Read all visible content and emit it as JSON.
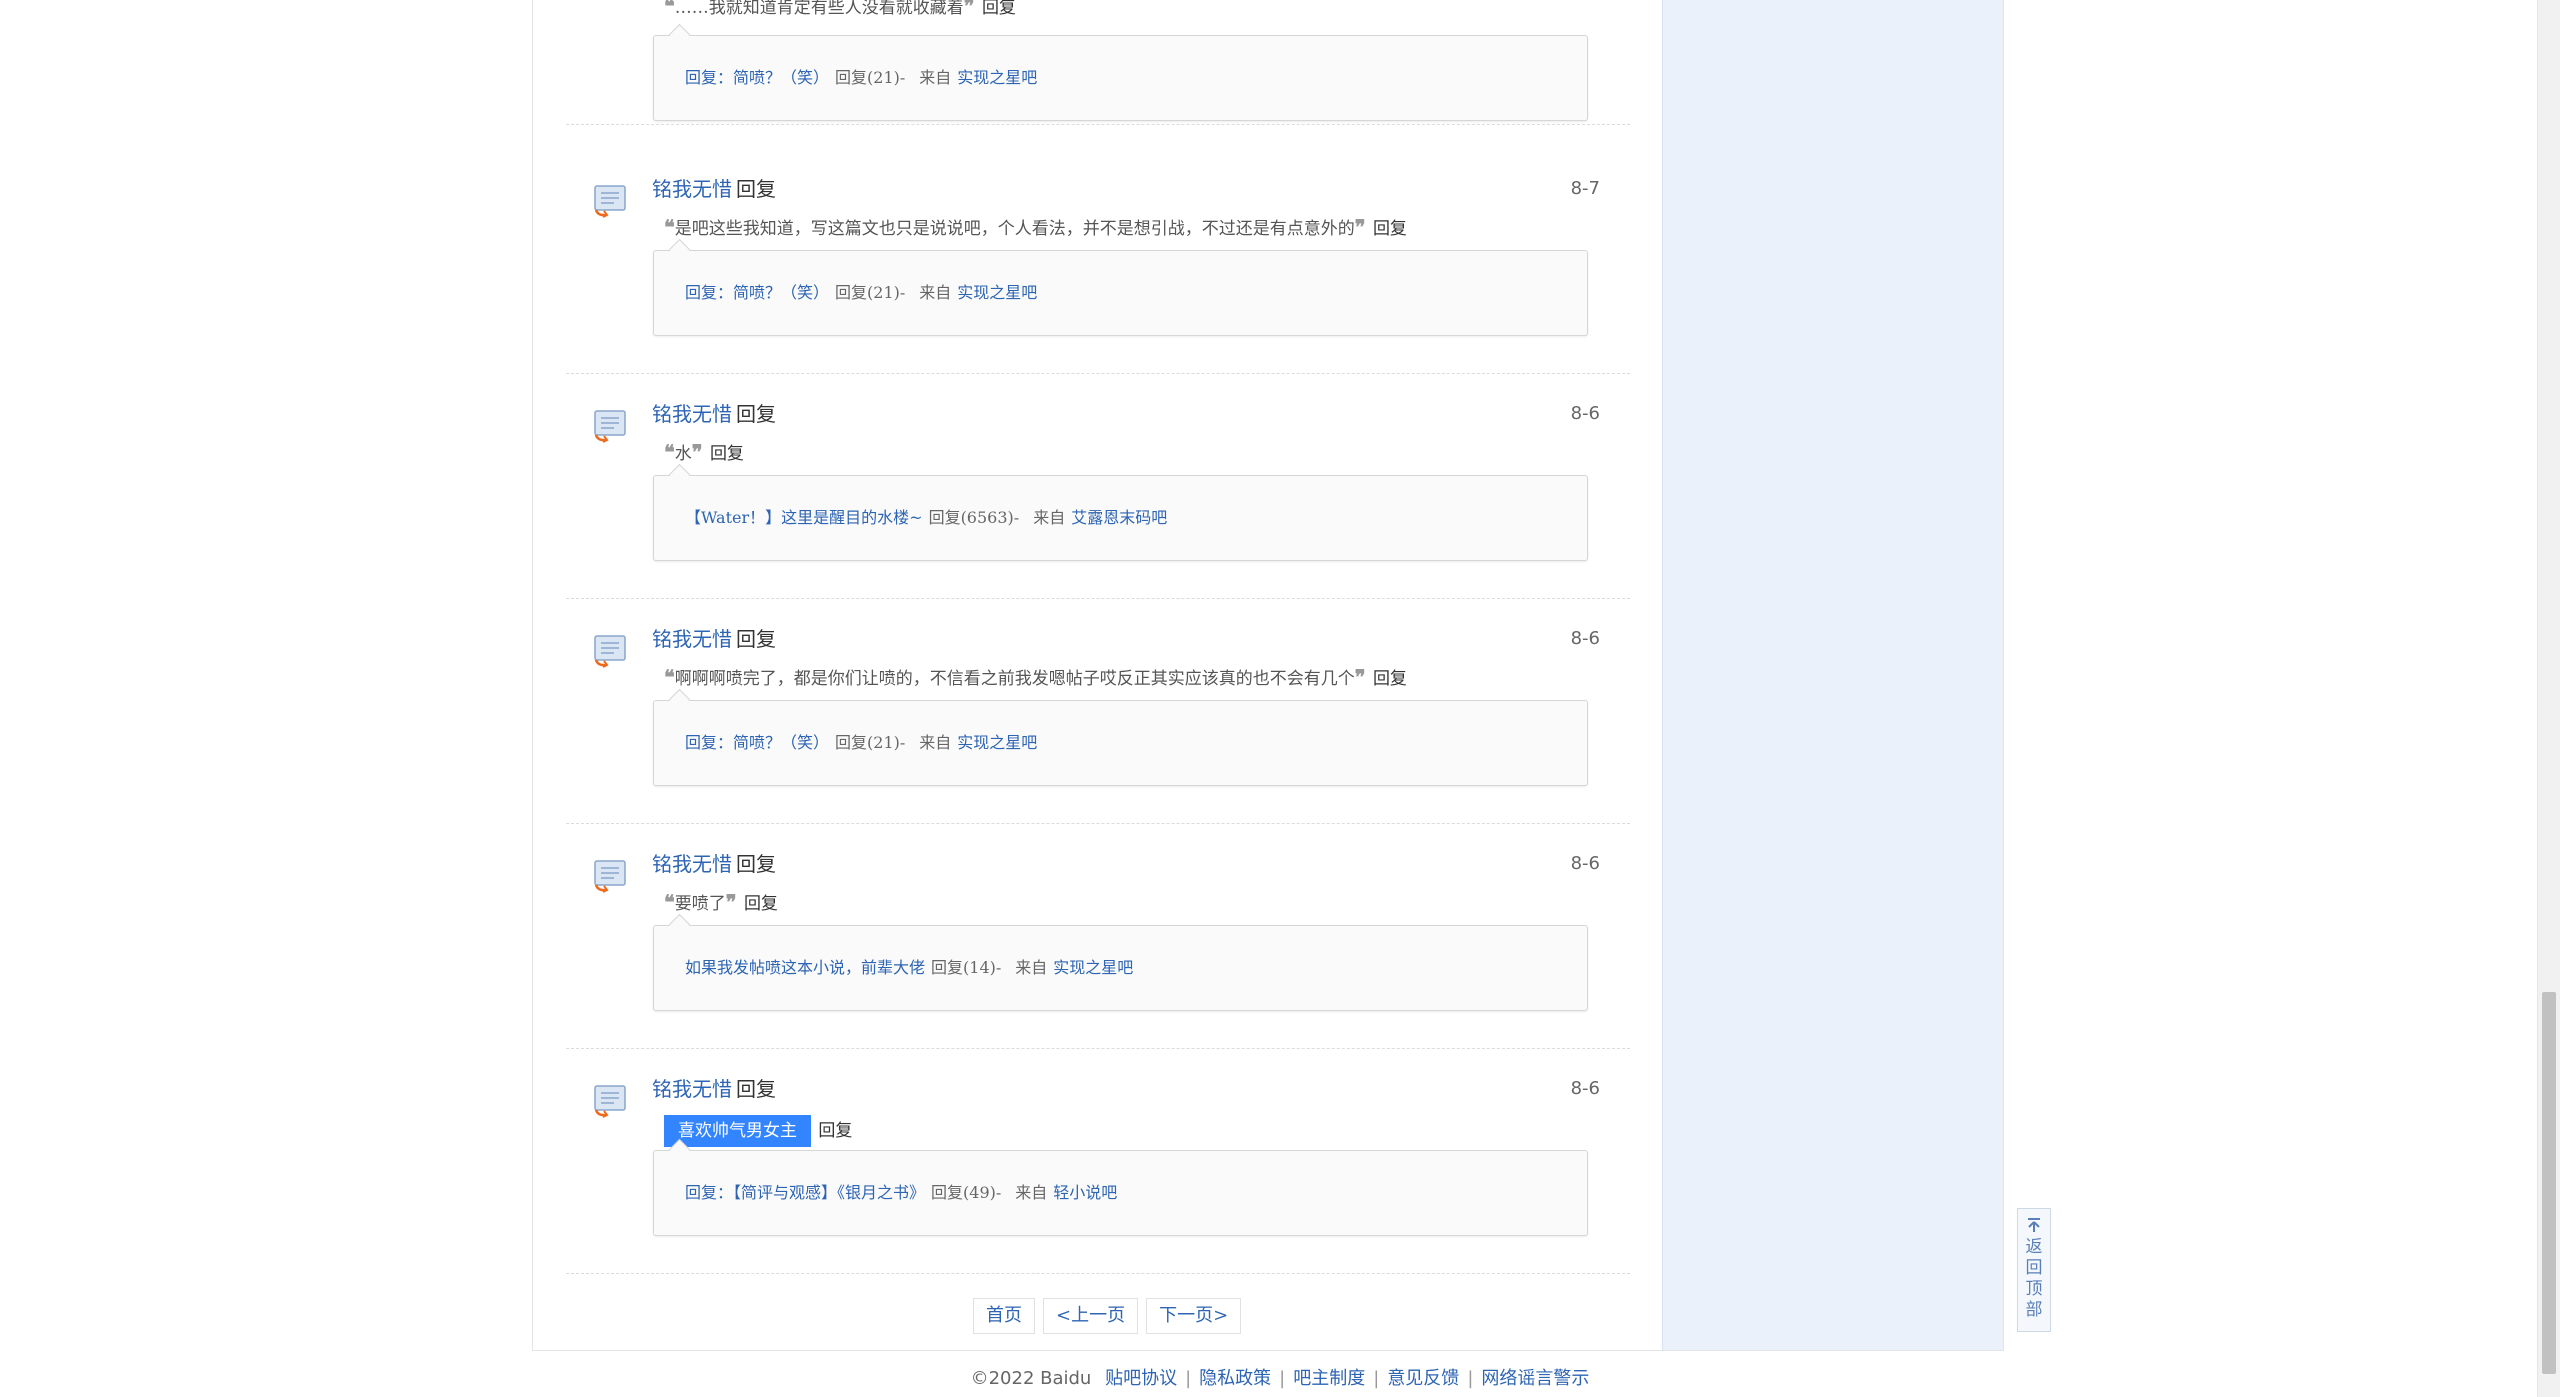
{
  "posts": [
    {
      "user": "",
      "verb": "",
      "date": "",
      "quote_open": "❝",
      "quote_text": "……我就知道肯定有些人没看就收藏着",
      "quote_close": "❞",
      "quote_reply": "回复",
      "ref_title": "回复：简喷？（笑）",
      "ref_count": "回复(21)-",
      "ref_from": "来自",
      "ref_forum": "实现之星吧"
    },
    {
      "user": "铭我无惜",
      "verb": "回复",
      "date": "8-7",
      "quote_open": "❝",
      "quote_text": "是吧这些我知道，写这篇文也只是说说吧，个人看法，并不是想引战，不过还是有点意外的",
      "quote_close": "❞",
      "quote_reply": "回复",
      "ref_title": "回复：简喷？（笑）",
      "ref_count": "回复(21)-",
      "ref_from": "来自",
      "ref_forum": "实现之星吧"
    },
    {
      "user": "铭我无惜",
      "verb": "回复",
      "date": "8-6",
      "quote_open": "❝",
      "quote_text": "水",
      "quote_close": "❞",
      "quote_reply": "回复",
      "ref_title": "【Water！】这里是醒目的水楼~",
      "ref_count": "回复(6563)-",
      "ref_from": "来自",
      "ref_forum": "艾露恩末码吧"
    },
    {
      "user": "铭我无惜",
      "verb": "回复",
      "date": "8-6",
      "quote_open": "❝",
      "quote_text": "啊啊啊喷完了，都是你们让喷的，不信看之前我发嗯帖子哎反正其实应该真的也不会有几个",
      "quote_close": "❞",
      "quote_reply": "回复",
      "ref_title": "回复：简喷？（笑）",
      "ref_count": "回复(21)-",
      "ref_from": "来自",
      "ref_forum": "实现之星吧"
    },
    {
      "user": "铭我无惜",
      "verb": "回复",
      "date": "8-6",
      "quote_open": "❝",
      "quote_text": "要喷了",
      "quote_close": "❞",
      "quote_reply": "回复",
      "ref_title": "如果我发帖喷这本小说，前辈大佬",
      "ref_count": "回复(14)-",
      "ref_from": "来自",
      "ref_forum": "实现之星吧"
    },
    {
      "user": "铭我无惜",
      "verb": "回复",
      "date": "8-6",
      "quote_tag": "喜欢帅气男女主",
      "quote_reply": "回复",
      "ref_title": "回复：【简评与观感】《银月之书》",
      "ref_count": "回复(49)-",
      "ref_from": "来自",
      "ref_forum": "轻小说吧"
    }
  ],
  "pager": {
    "first": "首页",
    "prev": "<上一页",
    "next": "下一页>"
  },
  "footer": {
    "copyright": "©2022 Baidu",
    "links": [
      "贴吧协议",
      "隐私政策",
      "吧主制度",
      "意见反馈",
      "网络谣言警示"
    ],
    "separator": "|"
  },
  "back_to_top": {
    "label": "返回顶部"
  },
  "colors": {
    "link": "#2d64b3",
    "tag_bg": "#3385ff",
    "right_col_bg": "#eaf1fb"
  }
}
